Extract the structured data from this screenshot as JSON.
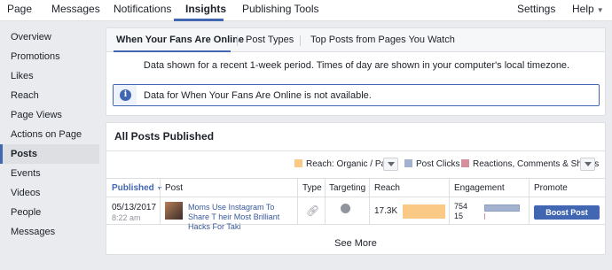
{
  "nav": {
    "page": "Page",
    "messages": "Messages",
    "notifications": "Notifications",
    "insights": "Insights",
    "publishing_tools": "Publishing Tools",
    "settings": "Settings",
    "help": "Help"
  },
  "sidebar": {
    "items": [
      {
        "label": "Overview"
      },
      {
        "label": "Promotions"
      },
      {
        "label": "Likes"
      },
      {
        "label": "Reach"
      },
      {
        "label": "Page Views"
      },
      {
        "label": "Actions on Page"
      },
      {
        "label": "Posts"
      },
      {
        "label": "Events"
      },
      {
        "label": "Videos"
      },
      {
        "label": "People"
      },
      {
        "label": "Messages"
      }
    ],
    "active": "Posts"
  },
  "fans_panel": {
    "tabs": [
      {
        "label": "When Your Fans Are Online"
      },
      {
        "label": "Post Types"
      },
      {
        "label": "Top Posts from Pages You Watch"
      }
    ],
    "notice": "Data shown for a recent 1-week period. Times of day are shown in your computer's local timezone.",
    "alert": "Data for When Your Fans Are Online is not available.",
    "alert_icon": "i"
  },
  "posts_panel": {
    "title": "All Posts Published",
    "legend": [
      {
        "label": "Reach: Organic / Paid",
        "color": "#fbc986"
      },
      {
        "label": "Post Clicks",
        "color": "#a3b2ce"
      },
      {
        "label": "Reactions, Comments & Shares",
        "color": "#d58f9c"
      }
    ],
    "columns": [
      "Published",
      "Post",
      "Type",
      "Targeting",
      "Reach",
      "Engagement",
      "Promote"
    ],
    "rows": [
      {
        "date": "05/13/2017",
        "time": "8:22 am",
        "post": "Moms Use Instagram To Share T heir Most Brilliant Hacks For Taki",
        "reach": "17.3K",
        "reach_fraction": 1.0,
        "post_clicks": "754",
        "reactions": "15",
        "post_clicks_fraction": 1.0,
        "reactions_fraction": 0.02,
        "promote": "Boost Post"
      }
    ],
    "see_more": "See More"
  }
}
